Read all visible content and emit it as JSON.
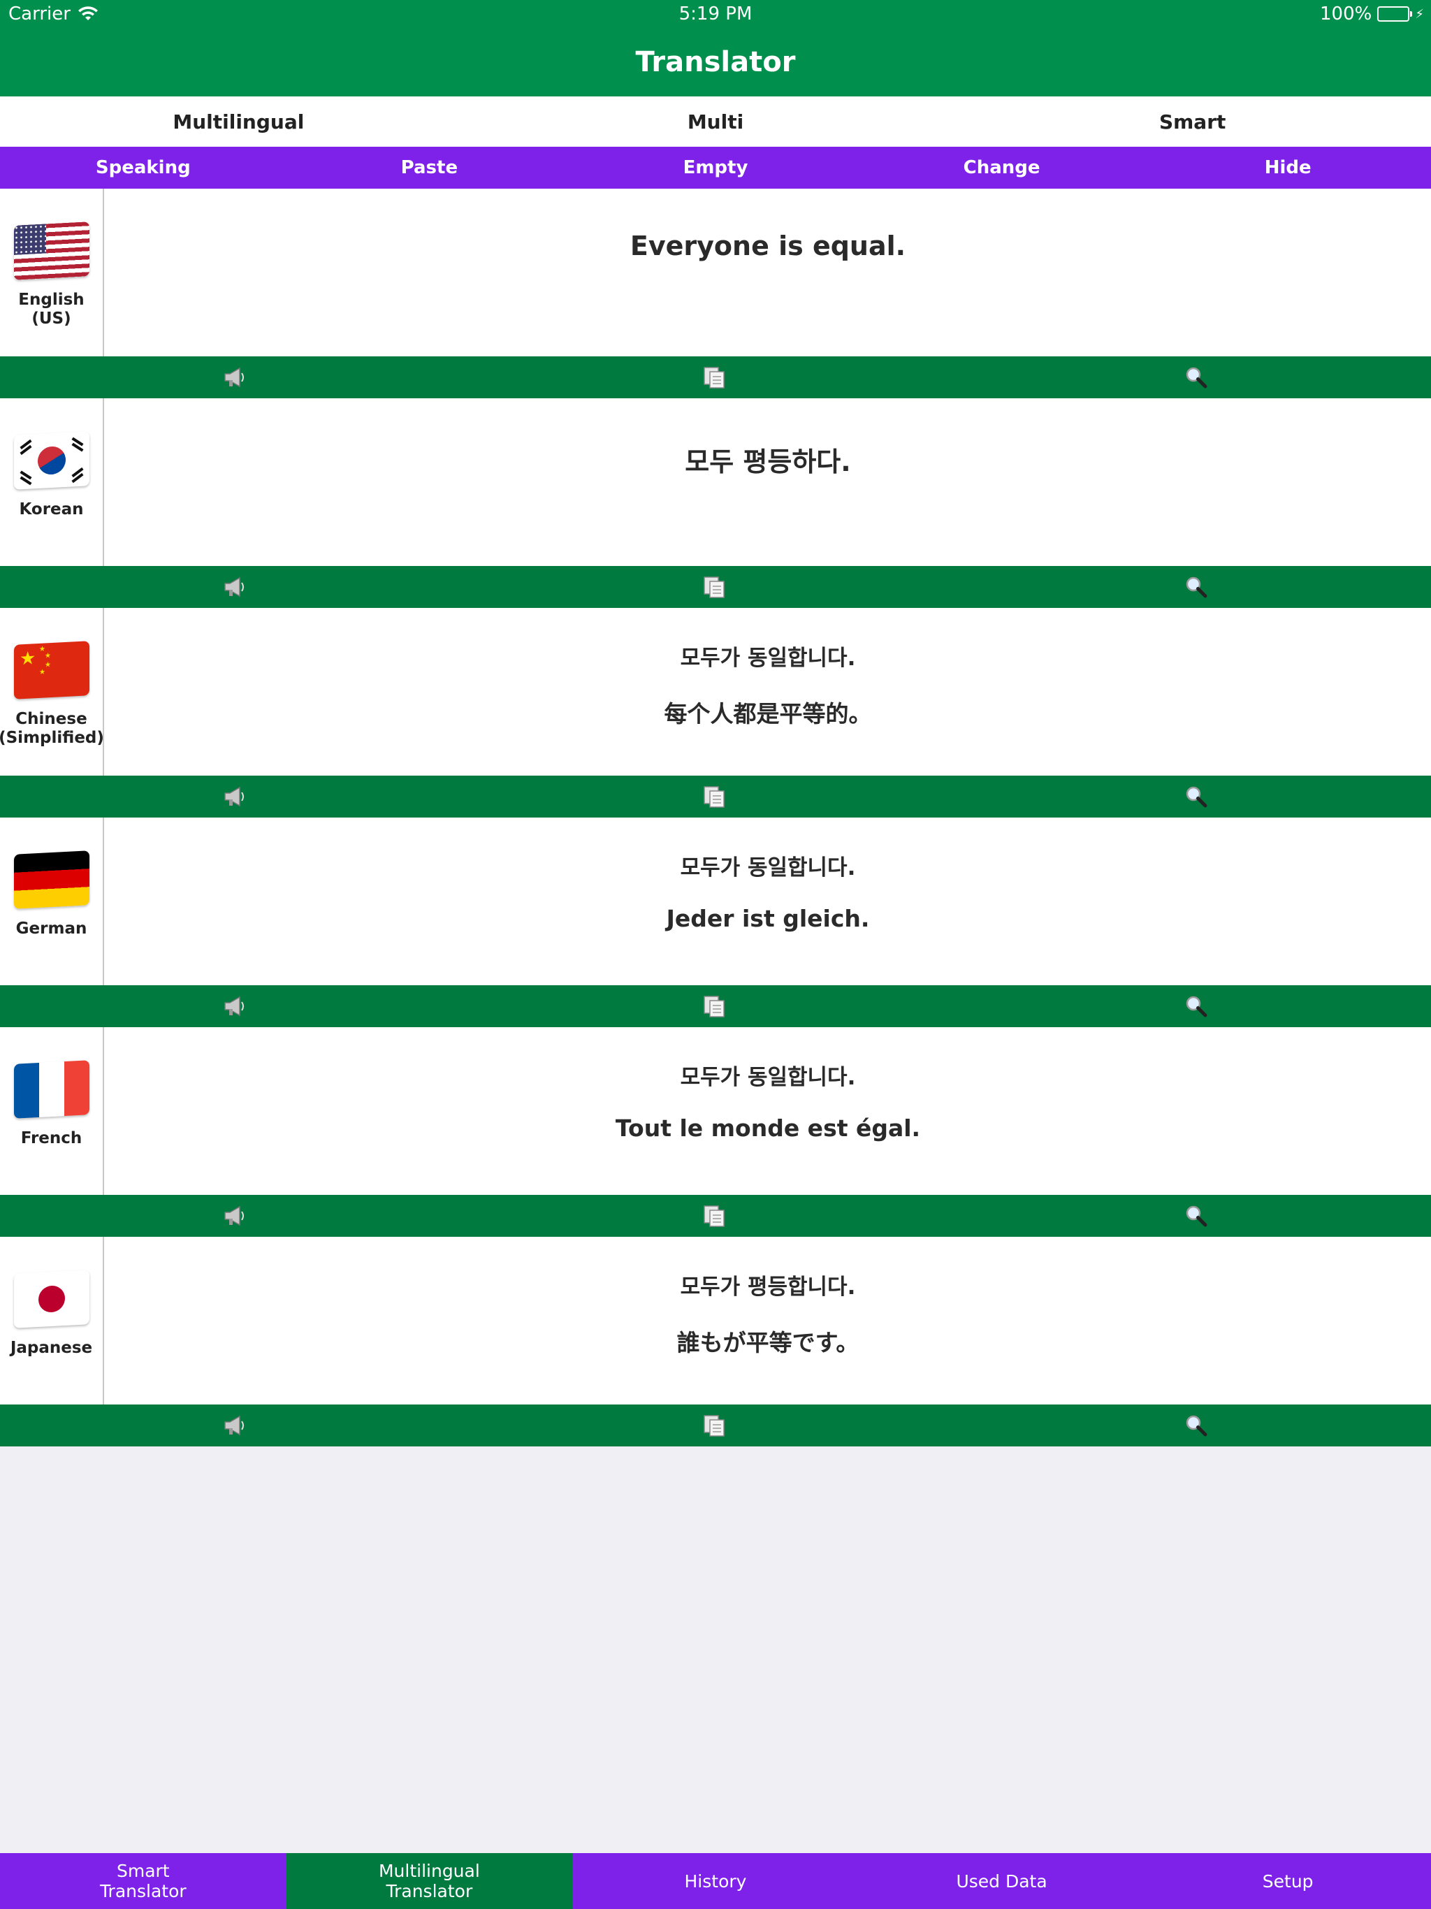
{
  "status_bar": {
    "carrier": "Carrier",
    "time": "5:19 PM",
    "battery": "100%"
  },
  "nav": {
    "title": "Translator"
  },
  "modes": [
    {
      "label": "Multilingual"
    },
    {
      "label": "Multi"
    },
    {
      "label": "Smart"
    }
  ],
  "toolbar": [
    {
      "label": "Speaking"
    },
    {
      "label": "Paste"
    },
    {
      "label": "Empty"
    },
    {
      "label": "Change"
    },
    {
      "label": "Hide"
    }
  ],
  "languages": [
    {
      "name": "English (US)",
      "flag": "us-flag-icon",
      "text": "Everyone is equal."
    },
    {
      "name": "Korean",
      "flag": "kr-flag-icon",
      "text": "모두 평등하다."
    },
    {
      "name_line1": "Chinese",
      "name_line2": "(Simplified)",
      "flag": "cn-flag-icon",
      "back": "모두가 동일합니다.",
      "text": "每个人都是平等的。"
    },
    {
      "name": "German",
      "flag": "de-flag-icon",
      "back": "모두가 동일합니다.",
      "text": "Jeder ist gleich."
    },
    {
      "name": "French",
      "flag": "fr-flag-icon",
      "back": "모두가 동일합니다.",
      "text": "Tout le monde est égal."
    },
    {
      "name": "Japanese",
      "flag": "jp-flag-icon",
      "back": "모두가 평등합니다.",
      "text": "誰もが平等です。"
    }
  ],
  "actions": {
    "icons": [
      "speaker-icon",
      "copy-icon",
      "search-icon"
    ]
  },
  "tabs": [
    {
      "line1": "Smart",
      "line2": "Translator",
      "active": false
    },
    {
      "line1": "Multilingual",
      "line2": "Translator",
      "active": true
    },
    {
      "label": "History",
      "active": false
    },
    {
      "label": "Used Data",
      "active": false
    },
    {
      "label": "Setup",
      "active": false
    }
  ],
  "colors": {
    "green": "#008f4c",
    "dark_green": "#007a3f",
    "purple": "#7e22ea",
    "background": "#efeff4"
  }
}
